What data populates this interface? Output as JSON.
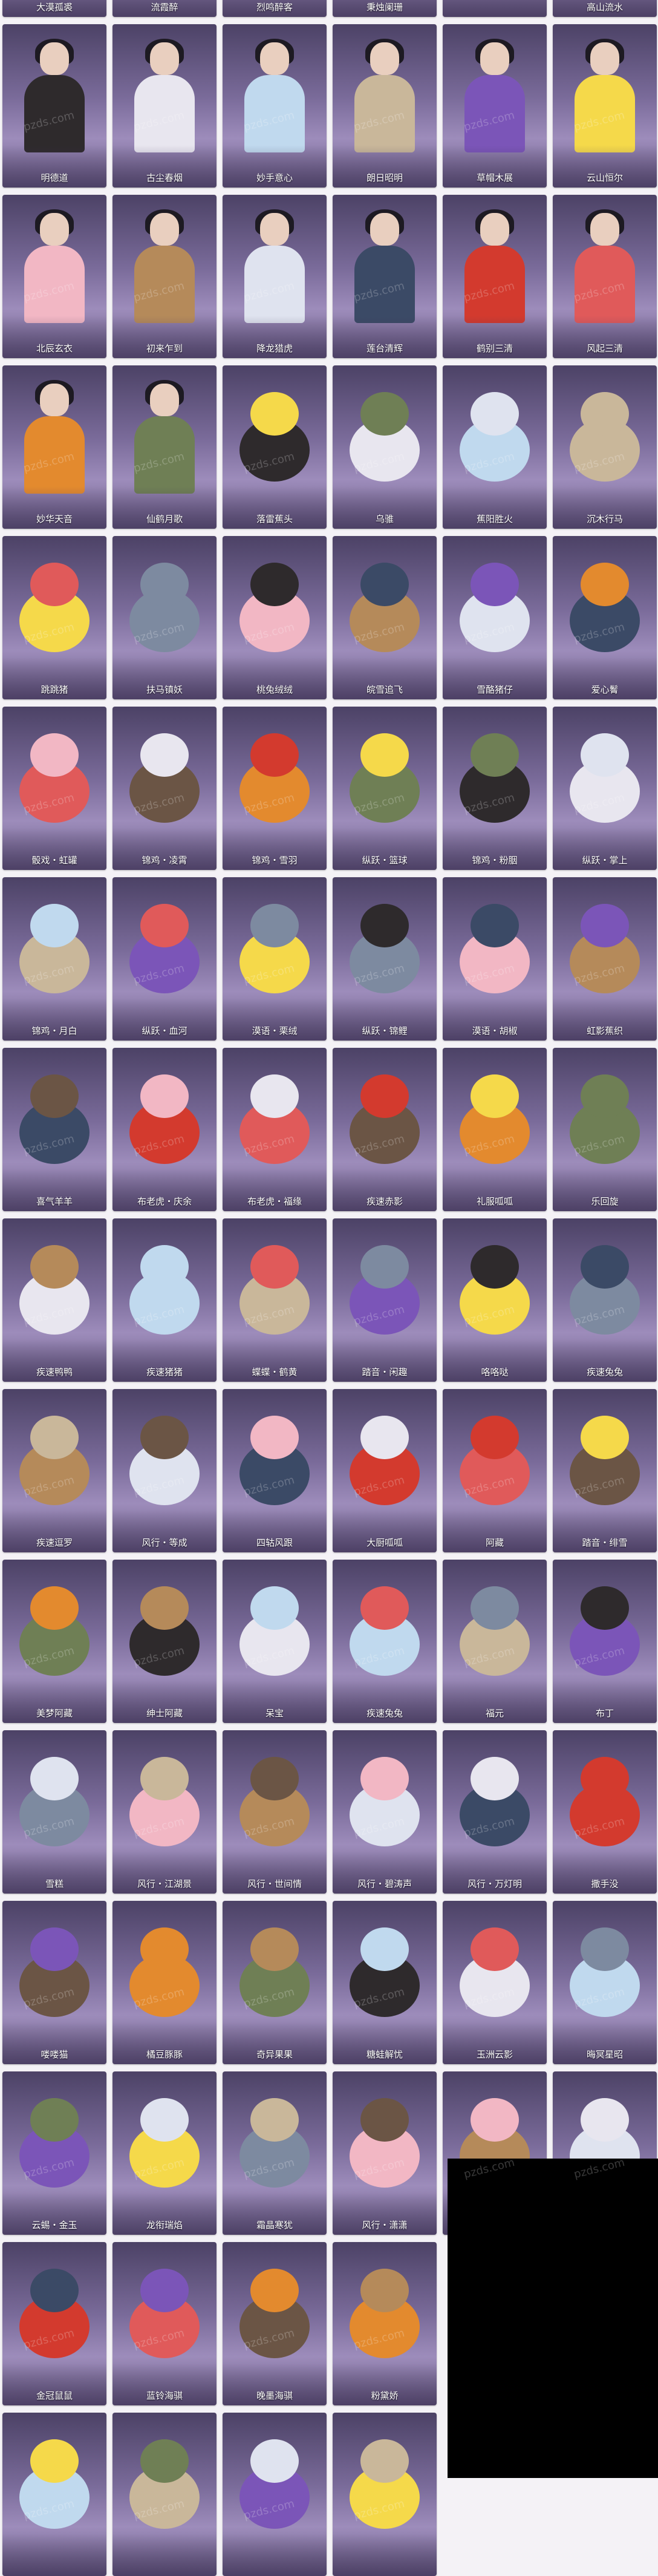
{
  "watermark": "pzds.com",
  "rows": [
    [
      "大漠孤裘",
      "流霞醉",
      "烈鸣醉客",
      "秉烛阑珊",
      "",
      "高山流水"
    ],
    [
      "明德道",
      "古尘春烟",
      "妙手意心",
      "朗日昭明",
      "草帽木展",
      "云山恒尔"
    ],
    [
      "北辰玄衣",
      "初来乍到",
      "降龙猎虎",
      "莲台清辉",
      "鹤别三清",
      "风起三清"
    ],
    [
      "妙华天音",
      "仙鹤月歌",
      "落雷蕉头",
      "乌骓",
      "蕉阳胜火",
      "沉木行马"
    ],
    [
      "跳跳猪",
      "扶马镇妖",
      "桃兔绒绒",
      "皖雪追飞",
      "雪酪猪仔",
      "爱心鬌"
    ],
    [
      "骰戏・虹罐",
      "锦鸡・凌霄",
      "锦鸡・雪羽",
      "纵跃・篮球",
      "锦鸡・粉胭",
      "纵跃・掌上"
    ],
    [
      "锦鸡・月白",
      "纵跃・血河",
      "漠语・栗绒",
      "纵跃・锦鲤",
      "漠语・胡椒",
      "虹影蕉织"
    ],
    [
      "喜气羊羊",
      "布老虎・庆余",
      "布老虎・福缘",
      "疾速赤影",
      "礼服呱呱",
      "乐回旋"
    ],
    [
      "疾速鸭鸭",
      "疾速猪猪",
      "蝶蝶・鹤黄",
      "踏音・闲趣",
      "咯咯哒",
      "疾速兔兔"
    ],
    [
      "疾速逗罗",
      "风行・等成",
      "四轱风跟",
      "大厨呱呱",
      "阿藏",
      "踏音・绯雪"
    ],
    [
      "美梦阿藏",
      "绅士阿藏",
      "呆宝",
      "疾速兔兔",
      "福元",
      "布丁"
    ],
    [
      "雪糕",
      "风行・江湖景",
      "风行・世间情",
      "风行・碧涛声",
      "风行・万灯明",
      "撒手没"
    ],
    [
      "喽喽猫",
      "橘豆豚豚",
      "奇异果果",
      "糖蛙解忧",
      "玉洲云影",
      "晦冥星昭"
    ],
    [
      "云蜴・金玉",
      "龙衔瑞焰",
      "霜晶寒犹",
      "风行・潇潇",
      "",
      ""
    ],
    [
      "金冠鼠鼠",
      "蓝铃海骐",
      "晚墨海骐",
      "粉黛娇",
      "",
      ""
    ],
    [
      "",
      "",
      "",
      "",
      "",
      ""
    ]
  ],
  "row_item_counts": [
    6,
    6,
    6,
    6,
    6,
    6,
    6,
    6,
    6,
    6,
    6,
    6,
    6,
    6,
    4,
    4
  ],
  "card_palette": [
    "#dfe3ef",
    "#7d8aa0",
    "#c9b79a",
    "#2e2a2c",
    "#6b5545",
    "#3b4a66",
    "#f2b7c4",
    "#7b55b8",
    "#e8e6ef",
    "#e38a2e",
    "#d33a2e",
    "#b58a5a",
    "#f5d94a",
    "#c0d9ee",
    "#6f7f55",
    "#e05a5a"
  ]
}
